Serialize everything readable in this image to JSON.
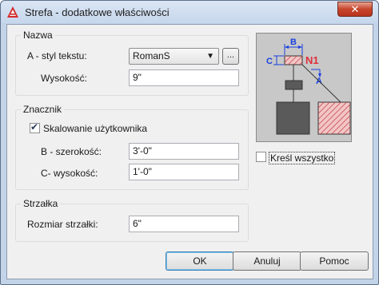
{
  "window": {
    "title": "Strefa - dodatkowe właściwości",
    "close_glyph": "✕",
    "app_icon": "autocad-a-icon"
  },
  "nazwa": {
    "group_title": "Nazwa",
    "style_label": "A - styl tekstu:",
    "style_value": "RomanS",
    "browse_label": "...",
    "height_label": "Wysokość:",
    "height_value": "9\""
  },
  "znacznik": {
    "group_title": "Znacznik",
    "scaling_label": "Skalowanie użytkownika",
    "scaling_checked": true,
    "width_label": "B - szerokość:",
    "width_value": "3'-0\"",
    "height_label": "C- wysokość:",
    "height_value": "1'-0\""
  },
  "strzalka": {
    "group_title": "Strzałka",
    "size_label": "Rozmiar strzałki:",
    "size_value": "6\""
  },
  "preview": {
    "label_b": "B",
    "label_c": "C",
    "label_n1": "N1",
    "label_a": "A",
    "draw_all_label": "Kreśl wszystko",
    "draw_all_checked": false,
    "accent_color": "#e0303a",
    "dim_color": "#1a3fe0"
  },
  "buttons": {
    "ok": "OK",
    "cancel": "Anuluj",
    "help": "Pomoc"
  }
}
